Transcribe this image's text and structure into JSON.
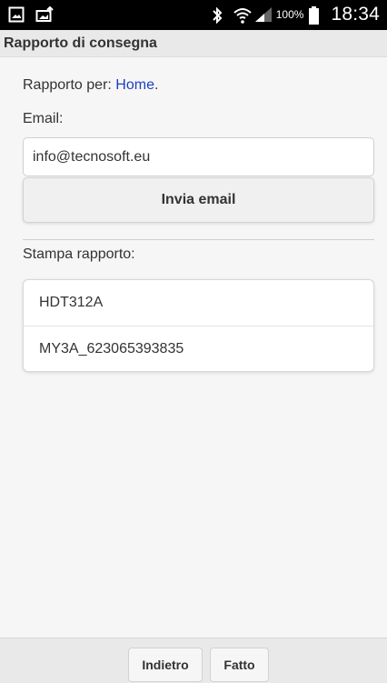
{
  "status_bar": {
    "left_icons": [
      "gallery-icon",
      "photo-upload-icon"
    ],
    "right_icons": [
      "bluetooth-icon",
      "wifi-icon",
      "signal-icon",
      "battery-icon"
    ],
    "battery": "100%",
    "time": "18:34"
  },
  "header": {
    "title": "Rapporto di consegna"
  },
  "report": {
    "label": "Rapporto per: ",
    "link": "Home",
    "suffix": "."
  },
  "email": {
    "label": "Email:",
    "value": "info@tecnosoft.eu",
    "send_button": "Invia email"
  },
  "print": {
    "label": "Stampa rapporto:",
    "items": [
      "HDT312A",
      "MY3A_623065393835"
    ]
  },
  "footer": {
    "back": "Indietro",
    "done": "Fatto"
  },
  "colors": {
    "link": "#1f3fbf",
    "background": "#f6f6f6",
    "header": "#e9e9e9"
  }
}
